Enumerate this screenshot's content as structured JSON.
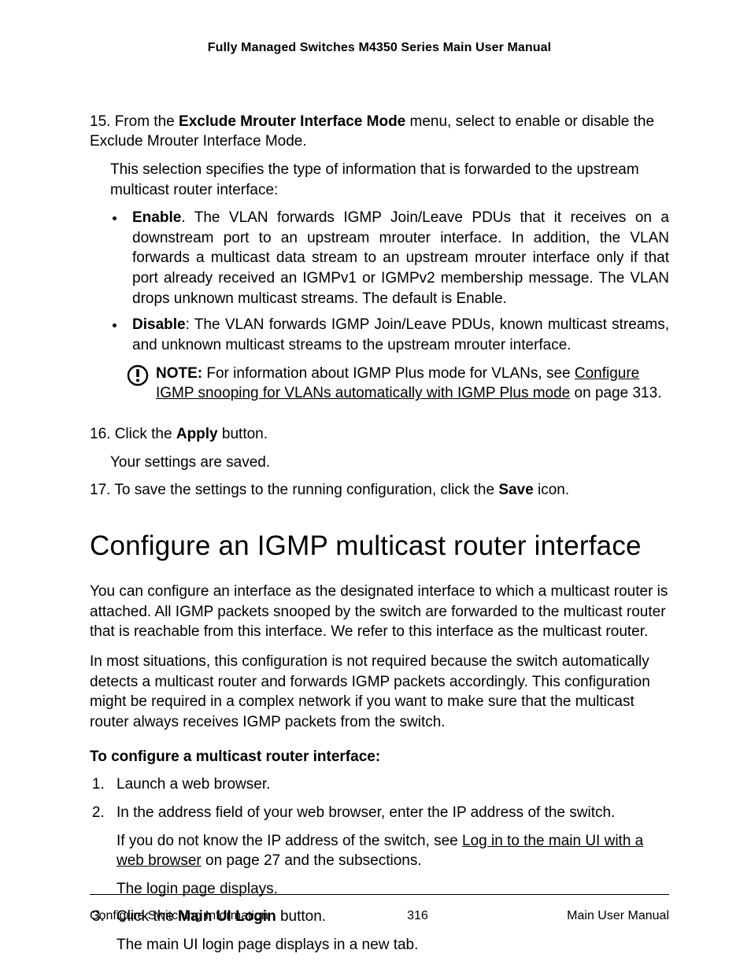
{
  "header": {
    "title": "Fully Managed Switches M4350 Series Main User Manual"
  },
  "body": {
    "s15": {
      "num": "15.",
      "lead_a": "From the ",
      "bold": "Exclude Mrouter Interface Mode",
      "lead_b": " menu, select to enable or disable the Exclude Mrouter Interface Mode.",
      "follow": "This selection specifies the type of information that is forwarded to the upstream multicast router interface:",
      "bullets": {
        "enable": {
          "label": "Enable",
          "text": ". The VLAN forwards IGMP Join/Leave PDUs that it receives on a downstream port to an upstream mrouter interface. In addition, the VLAN forwards a multicast data stream to an upstream mrouter interface only if that port already received an IGMPv1 or IGMPv2 membership message. The VLAN drops unknown multicast streams. The default is Enable."
        },
        "disable": {
          "label": "Disable",
          "text": ": The VLAN forwards IGMP Join/Leave PDUs, known multicast streams, and unknown multicast streams to the upstream mrouter interface."
        }
      },
      "note": {
        "label": "NOTE:",
        "pre": "  For information about IGMP Plus mode for VLANs, see ",
        "link": "Configure IGMP snooping for VLANs automatically with IGMP Plus mode",
        "post": " on page 313."
      }
    },
    "s16": {
      "num": "16.",
      "lead_a": "Click the ",
      "bold": "Apply",
      "lead_b": " button.",
      "follow": "Your settings are saved."
    },
    "s17": {
      "num": "17.",
      "lead_a": "To save the settings to the running configuration, click the ",
      "bold": "Save",
      "lead_b": " icon."
    },
    "heading": "Configure an IGMP multicast router interface",
    "p1": "You can configure an interface as the designated interface to which a multicast router is attached. All IGMP packets snooped by the switch are forwarded to the multicast router that is reachable from this interface. We refer to this interface as the multicast router.",
    "p2": "In most situations, this configuration is not required because the switch automatically detects a multicast router and forwards IGMP packets accordingly. This configuration might be required in a complex network if you want to make sure that the multicast router always receives IGMP packets from the switch.",
    "subhead": "To configure a multicast router interface:",
    "ol": {
      "i1": "Launch a web browser.",
      "i2": {
        "main": "In the address field of your web browser, enter the IP address of the switch.",
        "sub_a": "If you do not know the IP address of the switch, see ",
        "link": "Log in to the main UI with a web browser",
        "sub_b": " on page 27 and the subsections.",
        "sub2": "The login page displays."
      },
      "i3": {
        "lead_a": "Click the ",
        "bold": "Main UI Login",
        "lead_b": " button.",
        "sub": "The main UI login page displays in a new tab."
      }
    }
  },
  "footer": {
    "left": "Configure Switching Information",
    "center": "316",
    "right": "Main User Manual"
  }
}
